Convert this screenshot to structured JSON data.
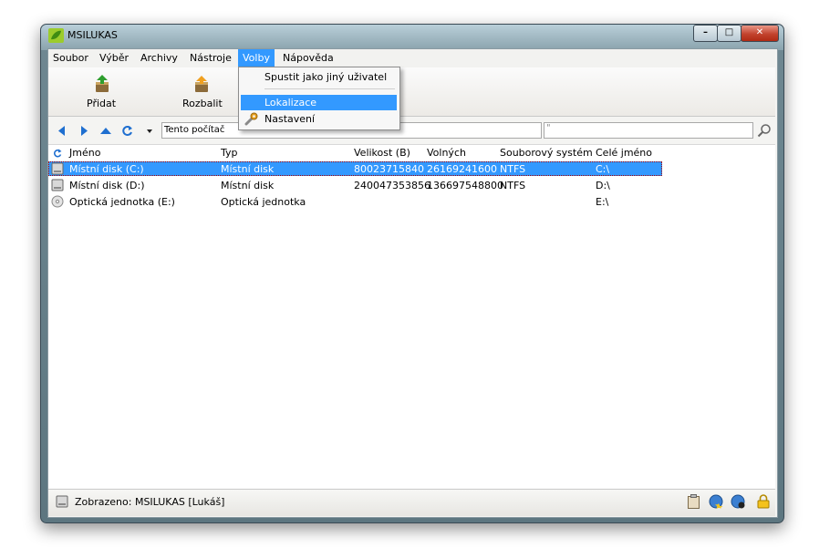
{
  "window": {
    "title": "MSILUKAS"
  },
  "menu": {
    "items": [
      {
        "label": "Soubor"
      },
      {
        "label": "Výběr"
      },
      {
        "label": "Archivy"
      },
      {
        "label": "Nástroje"
      },
      {
        "label": "Volby",
        "active": true
      },
      {
        "label": "Nápověda"
      }
    ]
  },
  "dropdown": {
    "items": [
      "Spustit jako jiný uživatel",
      "Lokalizace",
      "Nastavení"
    ],
    "highlighted": "Lokalizace"
  },
  "toolbar": {
    "add_label": "Přidat",
    "extract_label": "Rozbalit"
  },
  "nav": {
    "address": "Tento počítač",
    "search_value": "\""
  },
  "list": {
    "headers": [
      "Jméno",
      "Typ",
      "Velikost (B)",
      "Volných",
      "Souborový systém",
      "Celé jméno"
    ],
    "rows": [
      {
        "name": "Místní disk (C:)",
        "type": "Místní disk",
        "size": "80023715840",
        "free": "26169241600",
        "fs": "NTFS",
        "full": "C:\\",
        "selected": true,
        "icon": "hard-drive-icon"
      },
      {
        "name": "Místní disk (D:)",
        "type": "Místní disk",
        "size": "240047353856",
        "free": "136697548800",
        "fs": "NTFS",
        "full": "D:\\",
        "selected": false,
        "icon": "hard-drive-icon"
      },
      {
        "name": "Optická jednotka (E:)",
        "type": "Optická jednotka",
        "size": "",
        "free": "",
        "fs": "",
        "full": "E:\\",
        "selected": false,
        "icon": "optical-disc-icon"
      }
    ]
  },
  "status": {
    "text": "Zobrazeno: MSILUKAS [Lukáš]"
  },
  "colors": {
    "selection": "#3399ff",
    "menu_active": "#3399ff",
    "nav_arrow": "#1f6fd0"
  }
}
